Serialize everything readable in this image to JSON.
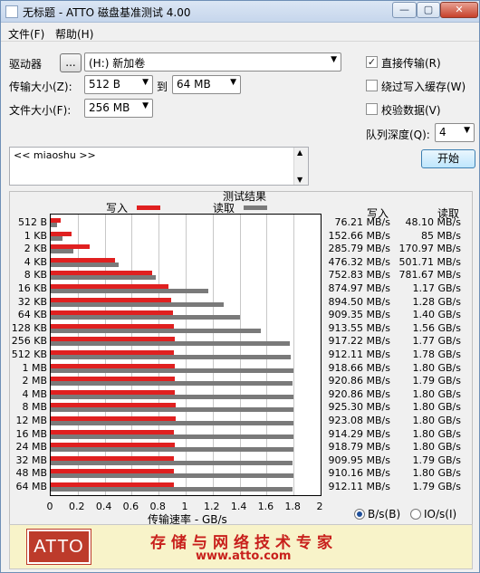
{
  "window": {
    "title": "无标题 - ATTO 磁盘基准测试 4.00",
    "min_label": "—",
    "max_label": "▢",
    "close_label": "✕"
  },
  "menu": {
    "file": "文件(F)",
    "help": "帮助(H)"
  },
  "controls": {
    "drive_label": "驱动器",
    "browse_label": "...",
    "drive_value": "(H:) 新加卷",
    "transfer_label": "传输大小(Z):",
    "transfer_from": "512 B",
    "to_label": "到",
    "transfer_to": "64 MB",
    "filesize_label": "文件大小(F):",
    "filesize_value": "256 MB",
    "direct_io_label": "直接传输(R)",
    "direct_io_checked": true,
    "bypass_cache_label": "绕过写入缓存(W)",
    "bypass_cache_checked": false,
    "verify_label": "校验数据(V)",
    "verify_checked": false,
    "queue_label": "队列深度(Q):",
    "queue_value": "4",
    "start_label": "开始",
    "description": "<< miaoshu >>"
  },
  "results": {
    "title": "测试结果",
    "write_legend": "写入",
    "read_legend": "读取",
    "write_header": "写入",
    "read_header": "读取",
    "unit_bs": "B/s(B)",
    "unit_ios": "IO/s(I)",
    "unit_bs_selected": true
  },
  "chart_data": {
    "type": "bar",
    "orientation": "horizontal",
    "title": "测试结果",
    "xlabel": "传输速率 - GB/s",
    "xlim": [
      0,
      2
    ],
    "xticks": [
      "0",
      "0.2",
      "0.4",
      "0.6",
      "0.8",
      "1",
      "1.2",
      "1.4",
      "1.6",
      "1.8",
      "2"
    ],
    "grid": true,
    "legend": "top",
    "categories": [
      "512 B",
      "1 KB",
      "2 KB",
      "4 KB",
      "8 KB",
      "16 KB",
      "32 KB",
      "64 KB",
      "128 KB",
      "256 KB",
      "512 KB",
      "1 MB",
      "2 MB",
      "4 MB",
      "8 MB",
      "12 MB",
      "16 MB",
      "24 MB",
      "32 MB",
      "48 MB",
      "64 MB"
    ],
    "series": [
      {
        "name": "写入",
        "color": "#e02020",
        "values": [
          0.07621,
          0.15266,
          0.28579,
          0.47632,
          0.75283,
          0.87497,
          0.8945,
          0.90935,
          0.91355,
          0.91722,
          0.91211,
          0.91866,
          0.92086,
          0.92086,
          0.9253,
          0.92308,
          0.91429,
          0.91879,
          0.90995,
          0.91016,
          0.91211
        ],
        "labels": [
          "76.21 MB/s",
          "152.66 MB/s",
          "285.79 MB/s",
          "476.32 MB/s",
          "752.83 MB/s",
          "874.97 MB/s",
          "894.50 MB/s",
          "909.35 MB/s",
          "913.55 MB/s",
          "917.22 MB/s",
          "912.11 MB/s",
          "918.66 MB/s",
          "920.86 MB/s",
          "920.86 MB/s",
          "925.30 MB/s",
          "923.08 MB/s",
          "914.29 MB/s",
          "918.79 MB/s",
          "909.95 MB/s",
          "910.16 MB/s",
          "912.11 MB/s"
        ]
      },
      {
        "name": "读取",
        "color": "#7a7a7a",
        "values": [
          0.0481,
          0.085,
          0.17097,
          0.50171,
          0.78167,
          1.17,
          1.28,
          1.4,
          1.56,
          1.77,
          1.78,
          1.8,
          1.79,
          1.8,
          1.8,
          1.8,
          1.8,
          1.8,
          1.79,
          1.8,
          1.79
        ],
        "labels": [
          "48.10 MB/s",
          "85 MB/s",
          "170.97 MB/s",
          "501.71 MB/s",
          "781.67 MB/s",
          "1.17 GB/s",
          "1.28 GB/s",
          "1.40 GB/s",
          "1.56 GB/s",
          "1.77 GB/s",
          "1.78 GB/s",
          "1.80 GB/s",
          "1.79 GB/s",
          "1.80 GB/s",
          "1.80 GB/s",
          "1.80 GB/s",
          "1.80 GB/s",
          "1.80 GB/s",
          "1.79 GB/s",
          "1.80 GB/s",
          "1.79 GB/s"
        ]
      }
    ]
  },
  "banner": {
    "logo": "ATTO",
    "slogan": "存储与网络技术专家",
    "url": "www.atto.com"
  }
}
